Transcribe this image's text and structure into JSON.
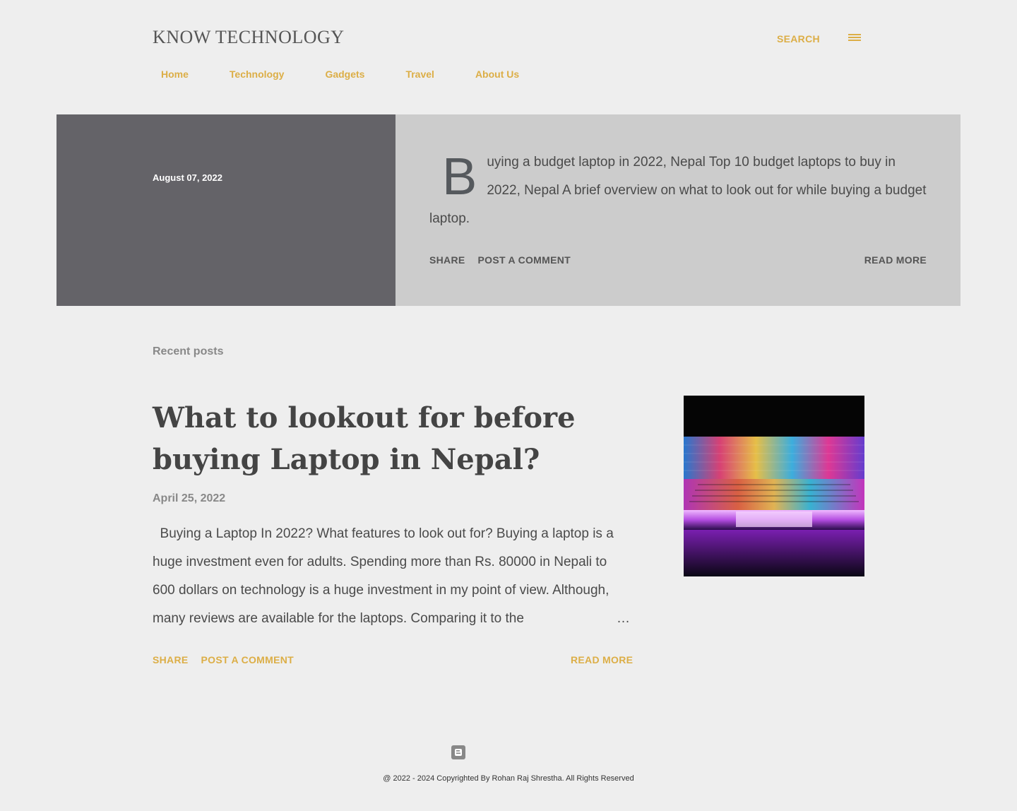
{
  "header": {
    "blog_title": "Know Technology",
    "search_label": "Search",
    "menu_icon": "hamburger-menu-icon"
  },
  "nav": {
    "items": [
      {
        "label": "Home"
      },
      {
        "label": "Technology"
      },
      {
        "label": "Gadgets"
      },
      {
        "label": "Travel"
      },
      {
        "label": "About Us"
      }
    ]
  },
  "featured": {
    "date": "August 07, 2022",
    "dropcap": "B",
    "snippet": "uying a budget laptop in 2022, Nepal Top 10 budget laptops to buy in 2022, Nepal A brief overview on what to look out for while buying a budget laptop.",
    "share_label": "Share",
    "comment_label": "Post a Comment",
    "read_more_label": "Read more"
  },
  "recent": {
    "heading": "Recent posts",
    "post": {
      "title": "What to lookout for before buying Laptop in Nepal?",
      "date": "April 25, 2022",
      "snippet": "  Buying a Laptop In 2022? What features to look out for? Buying a laptop is a huge investment even for adults. Spending more than Rs. 80000 in Nepali to 600 dollars on technology is a huge investment in my point of view. Although, many reviews are available for the laptops. Comparing it to the",
      "ellipsis": "…",
      "share_label": "Share",
      "comment_label": "Post a Comment",
      "read_more_label": "Read more",
      "thumbnail": "laptop-rainbow-keyboard-image"
    }
  },
  "footer": {
    "icon": "blogger-icon",
    "copyright": "@ 2022 - 2024 Copyrighted By Rohan Raj Shrestha. All Rights Reserved"
  },
  "colors": {
    "accent": "#dcae46",
    "background": "#eeeeee",
    "hero_left": "#646368",
    "hero_right": "#cccccc"
  }
}
